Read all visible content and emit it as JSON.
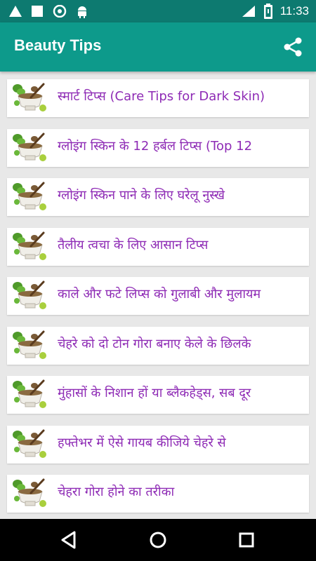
{
  "status_bar": {
    "time": "11:33",
    "icons_left": [
      "warning-icon",
      "square-icon",
      "camera-icon",
      "android-icon"
    ],
    "icons_right": [
      "wifi-icon",
      "battery-icon"
    ],
    "color": "#0d7a70"
  },
  "app_bar": {
    "title": "Beauty Tips",
    "share_icon": "share-icon",
    "color": "#0d9a8b"
  },
  "tips": [
    {
      "label": "स्मार्ट टिप्स (Care Tips for Dark Skin)"
    },
    {
      "label": "ग्लोइंग स्किन के 12 हर्बल टिप्स (Top 12"
    },
    {
      "label": "ग्लोइंग स्किन पाने के  लिए घरेलू नुस्खे"
    },
    {
      "label": "तैलीय त्वचा के  लिए आसान टिप्स"
    },
    {
      "label": "काले और फटे लिप्स को गुलाबी और मुलायम"
    },
    {
      "label": "चेहरे को दो टोन गोरा बनाए केले के  छिलके"
    },
    {
      "label": "मुंहासों के  निशान हों या ब्लैकहेड्स, सब दूर"
    },
    {
      "label": "हफ्तेभर में ऐसे गायब कीजिये चेहरे से"
    },
    {
      "label": "चेहरा गोरा होने का तरीका"
    }
  ],
  "text_color": "#8e2bb5",
  "nav_bar": {
    "icons": [
      "back-icon",
      "home-icon",
      "recents-icon"
    ]
  }
}
